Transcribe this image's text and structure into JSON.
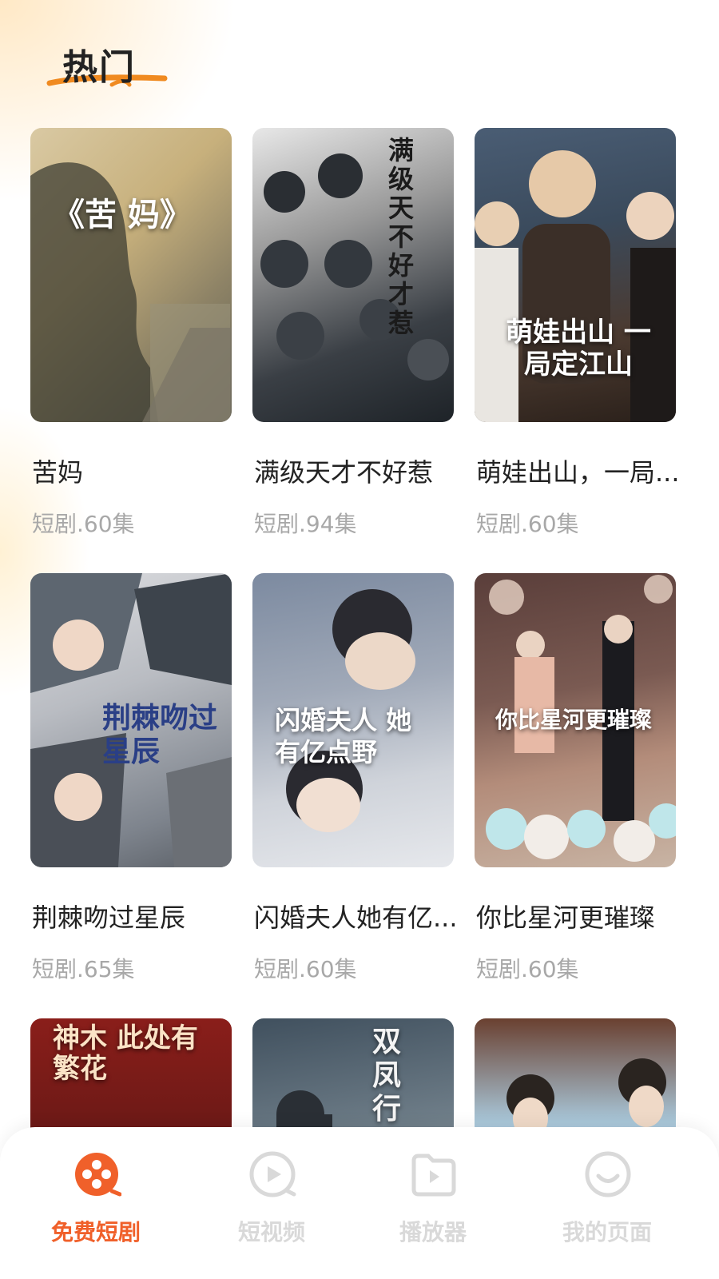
{
  "header": {
    "section_title": "热门"
  },
  "colors": {
    "accent": "#f0602a",
    "inactive": "#d9d9d9",
    "meta_text": "#a8a8a8"
  },
  "dramas": [
    {
      "poster_text": "《苦 妈》",
      "title": "苦妈",
      "meta": "短剧.60集"
    },
    {
      "poster_text": "满级天不好才惹",
      "title": "满级天才不好惹",
      "meta": "短剧.94集"
    },
    {
      "poster_text": "萌娃出山 一局定江山",
      "title": "萌娃出山，一局...",
      "meta": "短剧.60集"
    },
    {
      "poster_text": "荆棘吻过星辰",
      "title": "荆棘吻过星辰",
      "meta": "短剧.65集"
    },
    {
      "poster_text": "闪婚夫人 她有亿点野",
      "title": "闪婚夫人她有亿...",
      "meta": "短剧.60集"
    },
    {
      "poster_text": "你比星河更璀璨",
      "title": "你比星河更璀璨",
      "meta": "短剧.60集"
    },
    {
      "poster_text": "神木 此处有繁花",
      "title": "",
      "meta": ""
    },
    {
      "poster_text": "双凤行",
      "title": "",
      "meta": ""
    },
    {
      "poster_text": "",
      "title": "",
      "meta": ""
    }
  ],
  "bottom_nav": {
    "items": [
      {
        "label": "免费短剧",
        "icon": "film-reel-icon",
        "active": true
      },
      {
        "label": "短视频",
        "icon": "play-circle-icon",
        "active": false
      },
      {
        "label": "播放器",
        "icon": "folder-play-icon",
        "active": false
      },
      {
        "label": "我的页面",
        "icon": "smile-face-icon",
        "active": false
      }
    ]
  }
}
